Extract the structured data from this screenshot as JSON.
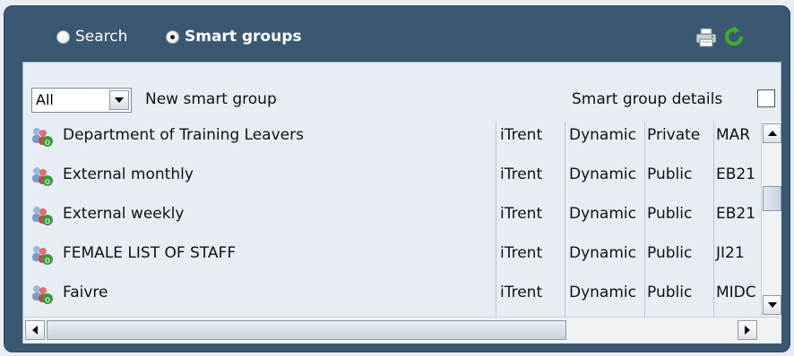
{
  "header": {
    "search_label": "Search",
    "smart_groups_label": "Smart groups",
    "selected_mode": "Smart groups"
  },
  "toolbar": {
    "filter_value": "All",
    "new_group_label": "New smart group",
    "details_label": "Smart group details",
    "details_checked": false
  },
  "groups": [
    {
      "name": "Department of Training Leavers",
      "source": "iTrent",
      "type": "Dynamic",
      "visibility": "Private",
      "code": "MAR"
    },
    {
      "name": "External monthly",
      "source": "iTrent",
      "type": "Dynamic",
      "visibility": "Public",
      "code": "EB21"
    },
    {
      "name": "External weekly",
      "source": "iTrent",
      "type": "Dynamic",
      "visibility": "Public",
      "code": "EB21"
    },
    {
      "name": "FEMALE LIST OF STAFF",
      "source": "iTrent",
      "type": "Dynamic",
      "visibility": "Public",
      "code": "JI21"
    },
    {
      "name": "Faivre",
      "source": "iTrent",
      "type": "Dynamic",
      "visibility": "Public",
      "code": "MIDC"
    }
  ],
  "icons": {
    "print": "printer-icon",
    "refresh": "refresh-icon",
    "group": "smart-group-icon"
  },
  "colors": {
    "panel": "#3b5873",
    "content": "#e8edf4",
    "refresh": "#3fae2a"
  }
}
